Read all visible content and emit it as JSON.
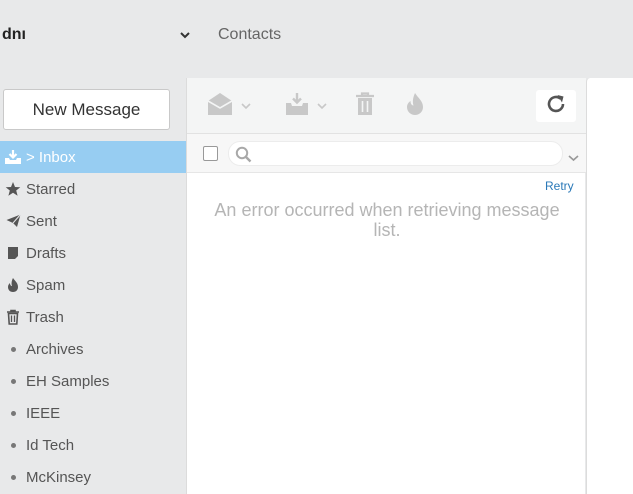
{
  "header": {
    "account": "dnı",
    "contacts_label": "Contacts"
  },
  "compose": {
    "new_message_label": "New Message"
  },
  "folders": [
    {
      "label": "> Inbox",
      "icon": "inbox-download-icon",
      "active": true
    },
    {
      "label": "Starred",
      "icon": "star-icon"
    },
    {
      "label": "Sent",
      "icon": "paper-plane-icon"
    },
    {
      "label": "Drafts",
      "icon": "file-icon"
    },
    {
      "label": "Spam",
      "icon": "fire-icon"
    },
    {
      "label": "Trash",
      "icon": "trash-icon"
    },
    {
      "label": "Archives",
      "icon": "bullet-icon"
    },
    {
      "label": "EH Samples",
      "icon": "bullet-icon"
    },
    {
      "label": "IEEE",
      "icon": "bullet-icon"
    },
    {
      "label": "Id Tech",
      "icon": "bullet-icon"
    },
    {
      "label": "McKinsey",
      "icon": "bullet-icon"
    }
  ],
  "message_list": {
    "search_placeholder": "",
    "retry_label": "Retry",
    "error_text": "An error occurred when retrieving message list."
  },
  "colors": {
    "active_folder_bg": "#97cdf2",
    "link": "#2a79b8",
    "disabled_icon": "#c8c8c8"
  }
}
